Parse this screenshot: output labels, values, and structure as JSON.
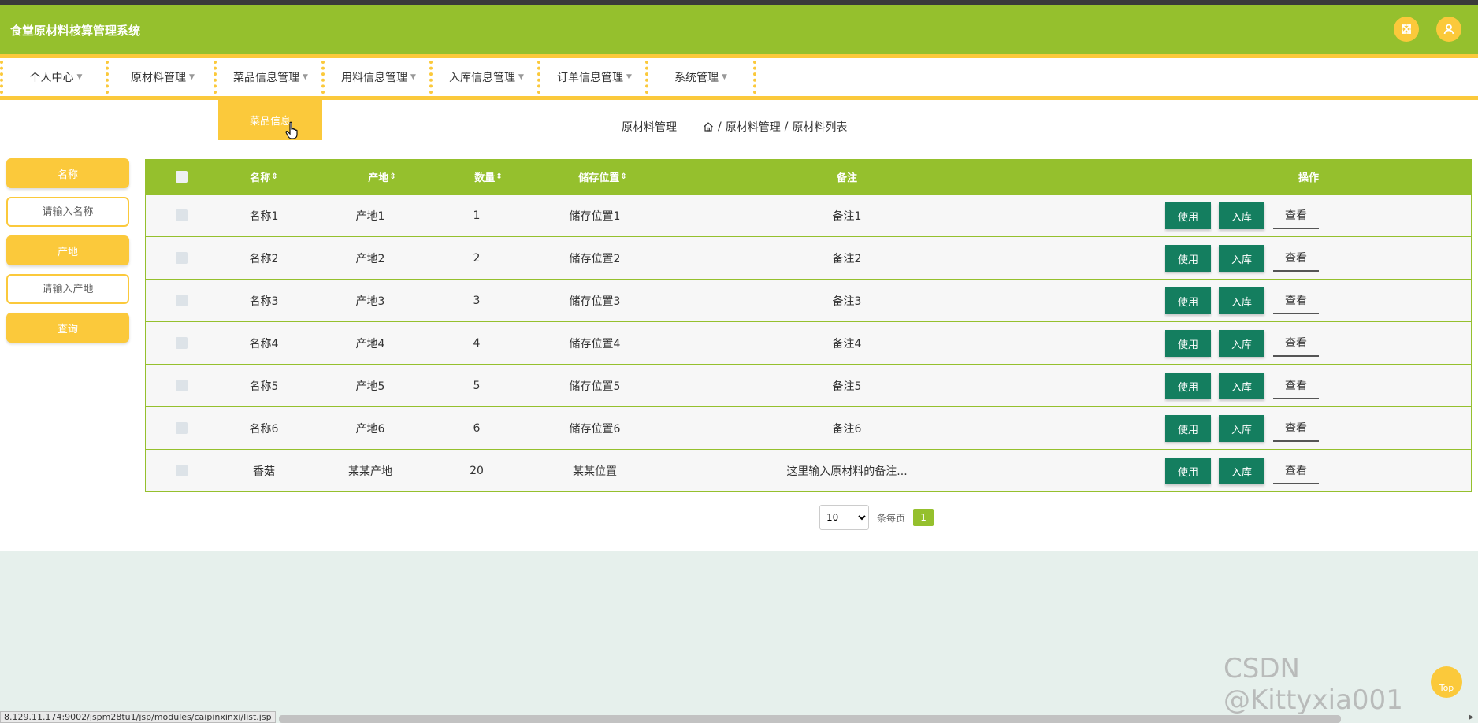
{
  "app": {
    "title": "食堂原材料核算管理系统"
  },
  "header": {
    "icons": [
      "fullscreen-icon",
      "user-icon"
    ]
  },
  "nav": [
    {
      "label": "个人中心"
    },
    {
      "label": "原材料管理"
    },
    {
      "label": "菜品信息管理"
    },
    {
      "label": "用料信息管理"
    },
    {
      "label": "入库信息管理"
    },
    {
      "label": "订单信息管理"
    },
    {
      "label": "系统管理"
    }
  ],
  "dropdown": {
    "item": "菜品信息"
  },
  "breadcrumb": {
    "title": "原材料管理",
    "path": [
      "原材料管理",
      "原材料列表"
    ],
    "sep": "/"
  },
  "sidebar": {
    "name_button": "名称",
    "name_placeholder": "请输入名称",
    "origin_button": "产地",
    "origin_placeholder": "请输入产地",
    "search_button": "查询"
  },
  "table": {
    "columns": [
      "名称",
      "产地",
      "数量",
      "储存位置",
      "备注",
      "操作"
    ],
    "sort_glyph": "⇕",
    "rows": [
      {
        "name": "名称1",
        "origin": "产地1",
        "qty": "1",
        "location": "储存位置1",
        "note": "备注1"
      },
      {
        "name": "名称2",
        "origin": "产地2",
        "qty": "2",
        "location": "储存位置2",
        "note": "备注2"
      },
      {
        "name": "名称3",
        "origin": "产地3",
        "qty": "3",
        "location": "储存位置3",
        "note": "备注3"
      },
      {
        "name": "名称4",
        "origin": "产地4",
        "qty": "4",
        "location": "储存位置4",
        "note": "备注4"
      },
      {
        "name": "名称5",
        "origin": "产地5",
        "qty": "5",
        "location": "储存位置5",
        "note": "备注5"
      },
      {
        "name": "名称6",
        "origin": "产地6",
        "qty": "6",
        "location": "储存位置6",
        "note": "备注6"
      },
      {
        "name": "香菇",
        "origin": "某某产地",
        "qty": "20",
        "location": "某某位置",
        "note": "这里输入原材料的备注..."
      }
    ],
    "actions": {
      "use": "使用",
      "stock": "入库",
      "view": "查看"
    }
  },
  "pagination": {
    "page_size": "10",
    "unit": "条每页",
    "current_page": "1"
  },
  "back_to_top": "Top",
  "watermark": "CSDN @Kittyxia001",
  "status_url": "8.129.11.174:9002/jspm28tu1/jsp/modules/caipinxinxi/list.jsp",
  "colors": {
    "green": "#95c02d",
    "yellow": "#fbc93b",
    "dark_green": "#147e5f",
    "page_bg": "#e6f0ec"
  }
}
